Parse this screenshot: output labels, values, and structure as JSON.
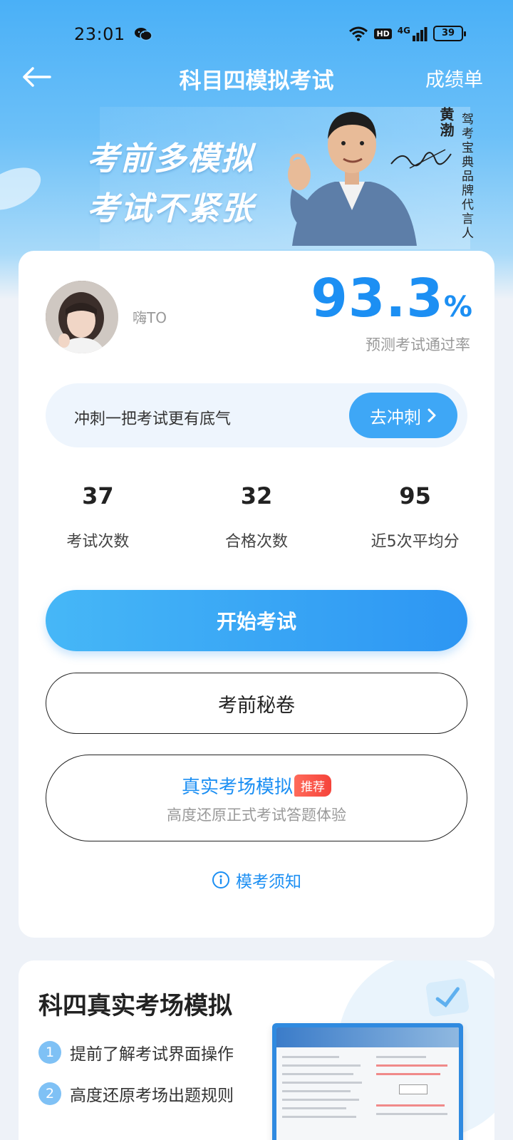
{
  "status_bar": {
    "time": "23:01",
    "battery": "39",
    "network": "4G",
    "hd": "HD"
  },
  "nav": {
    "title": "科目四模拟考试",
    "right_label": "成绩单"
  },
  "banner": {
    "slogan_line1": "考前多模拟",
    "slogan_line2": "考试不紧张",
    "endorser_name": "黄渤",
    "endorser_title": "驾考宝典品牌代言人"
  },
  "profile": {
    "username": "嗨TO",
    "pass_rate": "93.3",
    "pass_rate_unit": "%",
    "pass_rate_label": "预测考试通过率"
  },
  "sprint": {
    "text": "冲刺一把考试更有底气",
    "button": "去冲刺"
  },
  "stats": [
    {
      "value": "37",
      "label": "考试次数"
    },
    {
      "value": "32",
      "label": "合格次数"
    },
    {
      "value": "95",
      "label": "近5次平均分"
    }
  ],
  "buttons": {
    "start": "开始考试",
    "secret": "考前秘卷",
    "real_title": "真实考场模拟",
    "real_badge": "推荐",
    "real_subtitle": "高度还原正式考试答题体验",
    "notice": "模考须知"
  },
  "section2": {
    "title": "科四真实考场模拟",
    "features": [
      {
        "num": "1",
        "text": "提前了解考试界面操作"
      },
      {
        "num": "2",
        "text": "高度还原考场出题规则"
      }
    ]
  },
  "colors": {
    "accent": "#1c8ff3",
    "button_blue": "#3ea7f6",
    "badge_red": "#f5433a"
  }
}
